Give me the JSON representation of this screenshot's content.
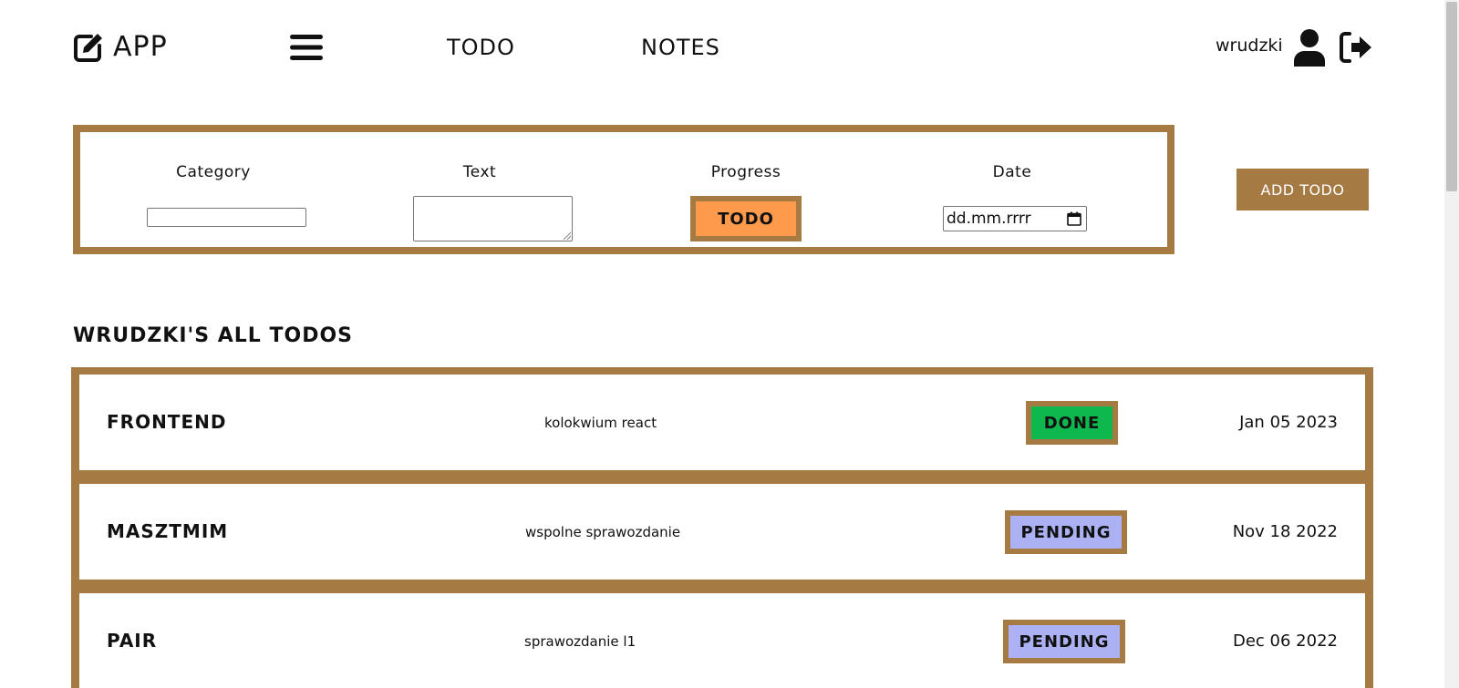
{
  "header": {
    "brand": "APP",
    "nav": {
      "todo": "TODO",
      "notes": "NOTES"
    },
    "username": "wrudzki",
    "icons": {
      "brand": "edit-icon",
      "menu": "hamburger-menu-icon",
      "user": "user-icon",
      "logout": "logout-icon"
    }
  },
  "form": {
    "category_label": "Category",
    "category_value": "",
    "text_label": "Text",
    "text_value": "",
    "progress_label": "Progress",
    "progress_value": "TODO",
    "date_label": "Date",
    "date_placeholder": "dd.mm.rrrr",
    "add_button": "ADD TODO"
  },
  "list": {
    "title": "WRUDZKI'S ALL TODOS",
    "items": [
      {
        "category": "FRONTEND",
        "text": "kolokwium react",
        "status": "DONE",
        "date": "Jan 05 2023"
      },
      {
        "category": "MASZTMIM",
        "text": "wspolne sprawozdanie",
        "status": "PENDING",
        "date": "Nov 18 2022"
      },
      {
        "category": "PAIR",
        "text": "sprawozdanie l1",
        "status": "PENDING",
        "date": "Dec 06 2022"
      }
    ]
  },
  "colors": {
    "accent": "#a57a43",
    "todo": "#fd9a4c",
    "done": "#0fb84e",
    "pending": "#abb1f2"
  }
}
